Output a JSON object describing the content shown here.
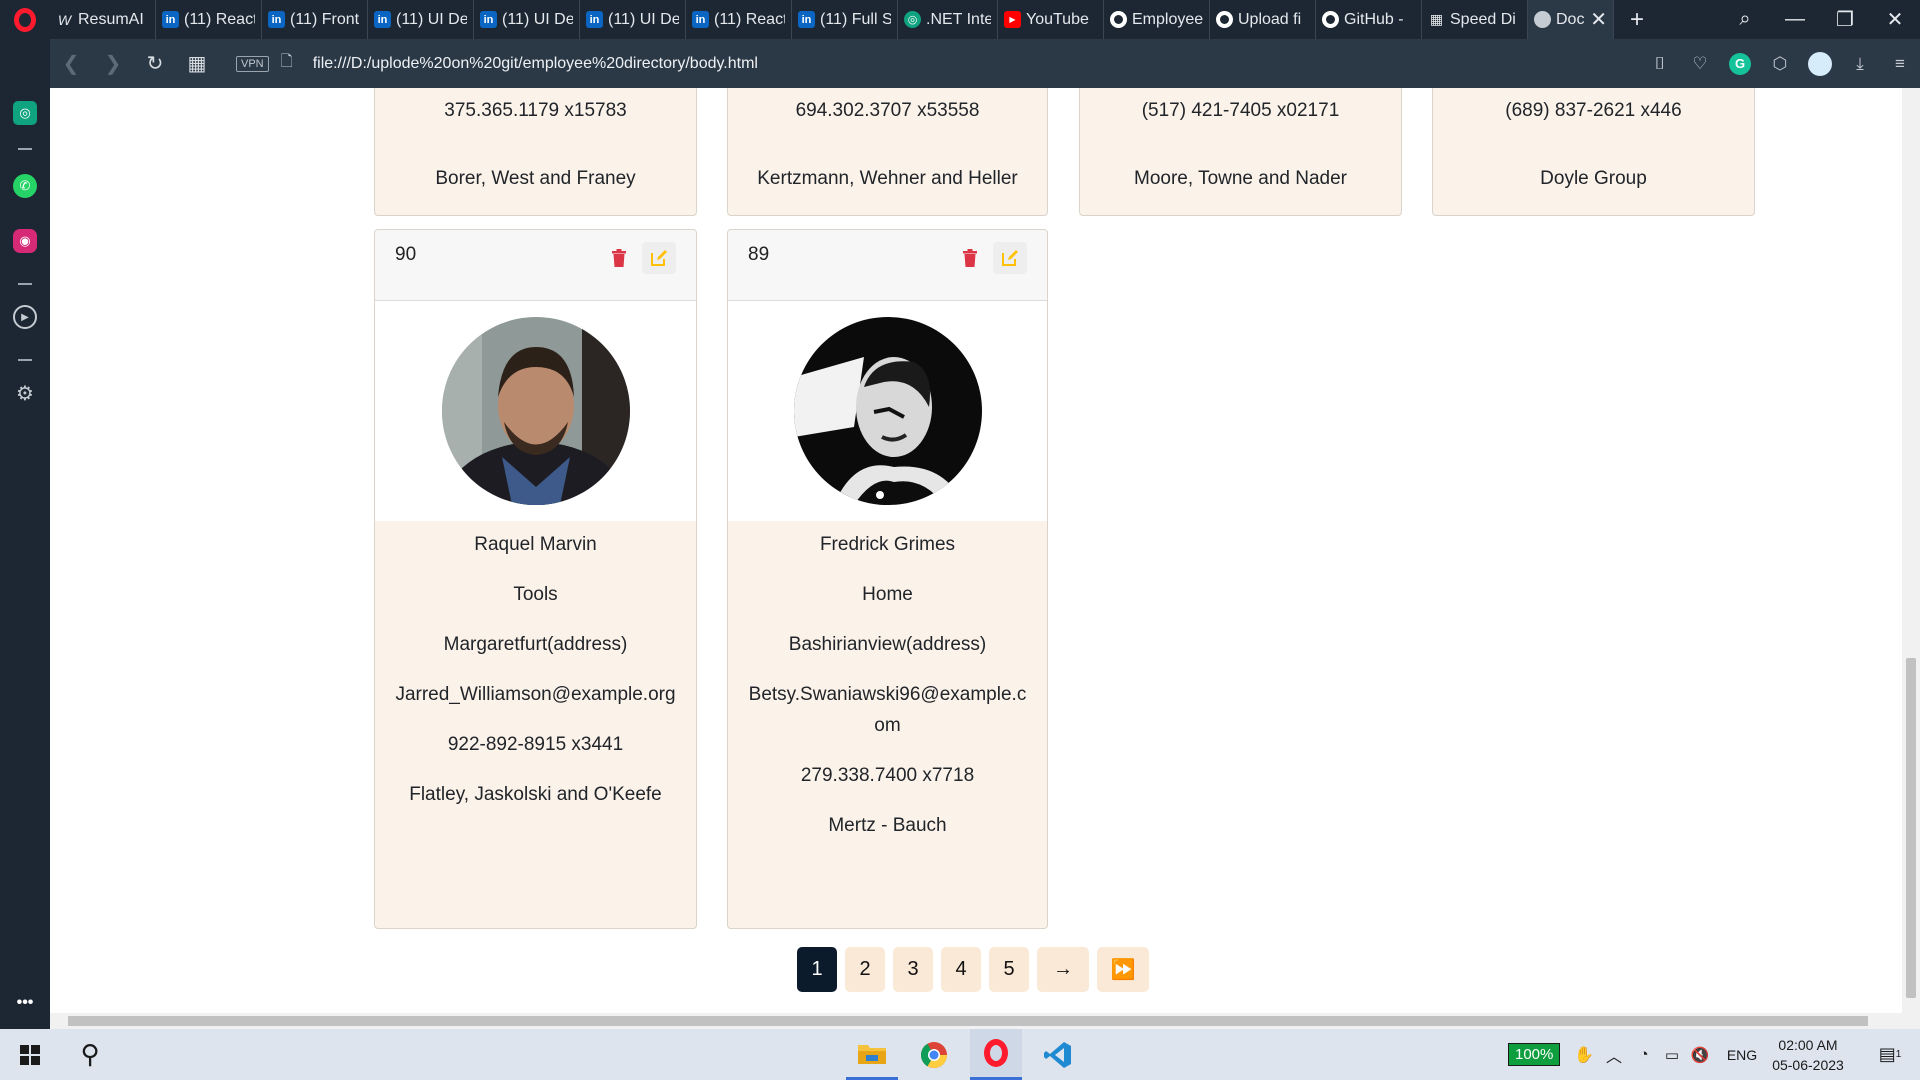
{
  "browser": {
    "tabs": [
      {
        "label": "ResumAI",
        "icon": "w"
      },
      {
        "label": "(11) React",
        "icon": "li"
      },
      {
        "label": "(11) Front",
        "icon": "li"
      },
      {
        "label": "(11) UI De",
        "icon": "li"
      },
      {
        "label": "(11) UI De",
        "icon": "li"
      },
      {
        "label": "(11) UI De",
        "icon": "li"
      },
      {
        "label": "(11) React",
        "icon": "li"
      },
      {
        "label": "(11) Full S",
        "icon": "li"
      },
      {
        "label": ".NET Inter",
        "icon": "gp"
      },
      {
        "label": "YouTube",
        "icon": "yt"
      },
      {
        "label": "Employee",
        "icon": "gh"
      },
      {
        "label": "Upload fi",
        "icon": "gh"
      },
      {
        "label": "GitHub -",
        "icon": "gh"
      },
      {
        "label": "Speed Di",
        "icon": "sd"
      },
      {
        "label": "Docu",
        "icon": "gl",
        "active": true
      }
    ],
    "url": "file:///D:/uplode%20on%20git/employee%20directory/body.html",
    "vpn_label": "VPN"
  },
  "top_cards": [
    {
      "phone": "375.365.1179 x15783",
      "company": "Borer, West and Franey"
    },
    {
      "phone": "694.302.3707 x53558",
      "company": "Kertzmann, Wehner and Heller"
    },
    {
      "phone": "(517) 421-7405 x02171",
      "company": "Moore, Towne and Nader"
    },
    {
      "phone": "(689) 837-2621 x446",
      "company": "Doyle Group"
    }
  ],
  "employees": [
    {
      "id": "90",
      "name": "Raquel Marvin",
      "department": "Tools",
      "address": "Margaretfurt(address)",
      "email": "Jarred_Williamson@example.org",
      "phone": "922-892-8915 x3441",
      "company": "Flatley, Jaskolski and O'Keefe"
    },
    {
      "id": "89",
      "name": "Fredrick Grimes",
      "department": "Home",
      "address": "Bashirianview(address)",
      "email": "Betsy.Swaniawski96@example.com",
      "phone": "279.338.7400 x7718",
      "company": "Mertz - Bauch"
    }
  ],
  "pagination": {
    "pages": [
      "1",
      "2",
      "3",
      "4",
      "5"
    ],
    "active_page": "1",
    "next_label": "→",
    "last_label": "⏩"
  },
  "taskbar": {
    "battery": "100%",
    "language": "ENG",
    "time": "02:00 AM",
    "date": "05-06-2023",
    "notification_count": "1"
  },
  "colors": {
    "delete_icon": "#dc3545",
    "edit_icon": "#ffc107",
    "card_body": "#fbf2ea",
    "pager_active": "#0c1b2b",
    "pager_inactive": "#fbe9d7"
  }
}
